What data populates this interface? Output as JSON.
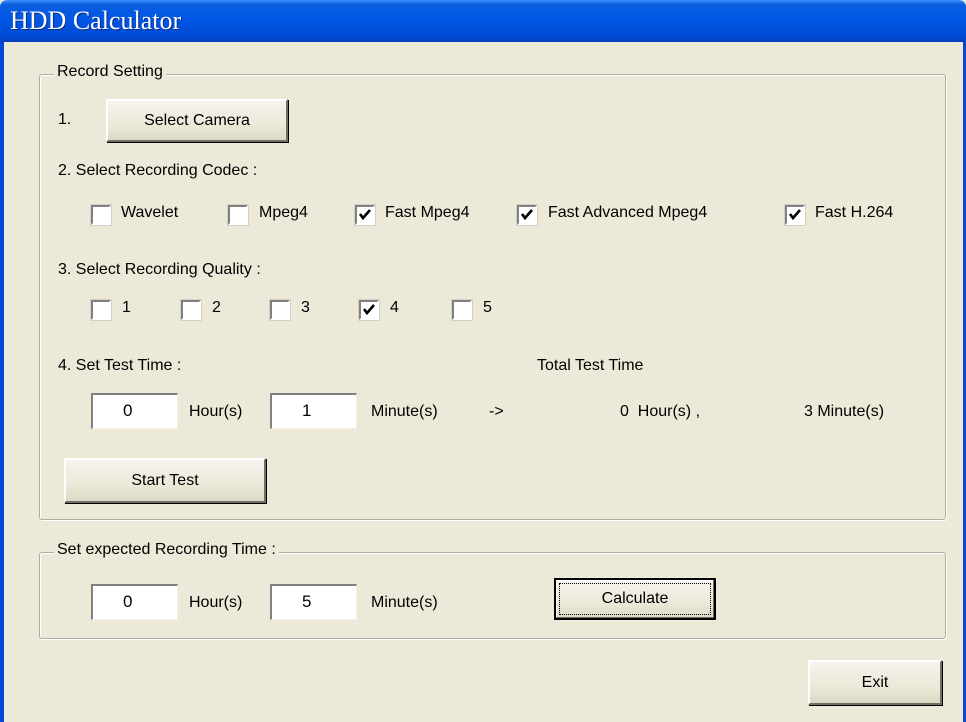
{
  "window": {
    "title": "HDD Calculator"
  },
  "record_setting": {
    "legend": "Record Setting",
    "step1_label": "1.",
    "select_camera_button": "Select Camera",
    "codec_label": "2. Select Recording Codec :",
    "codecs": [
      {
        "label": "Wavelet",
        "checked": false
      },
      {
        "label": "Mpeg4",
        "checked": false
      },
      {
        "label": "Fast Mpeg4",
        "checked": true
      },
      {
        "label": "Fast Advanced Mpeg4",
        "checked": true
      },
      {
        "label": "Fast H.264",
        "checked": true
      }
    ],
    "quality_label": "3. Select Recording Quality :",
    "qualities": [
      {
        "label": "1",
        "checked": false
      },
      {
        "label": "2",
        "checked": false
      },
      {
        "label": "3",
        "checked": false
      },
      {
        "label": "4",
        "checked": true
      },
      {
        "label": "5",
        "checked": false
      }
    ],
    "test_time_label": "4. Set Test Time :",
    "total_test_time_label": "Total Test Time",
    "test_hours_value": "0",
    "hours_unit": "Hour(s)",
    "test_minutes_value": "1",
    "minutes_unit": "Minute(s)",
    "arrow": "->",
    "total_hours": "0  Hour(s) ,",
    "total_minutes": "3 Minute(s)",
    "start_test_button": "Start Test"
  },
  "expected": {
    "legend": "Set expected Recording Time :",
    "hours_value": "0",
    "hours_unit": "Hour(s)",
    "minutes_value": "5",
    "minutes_unit": "Minute(s)",
    "calculate_button": "Calculate"
  },
  "footer": {
    "exit_button": "Exit"
  },
  "colors": {
    "titlebar": "#0055e5",
    "dialog_bg": "#ece9d8",
    "frame": "#0648d6"
  }
}
